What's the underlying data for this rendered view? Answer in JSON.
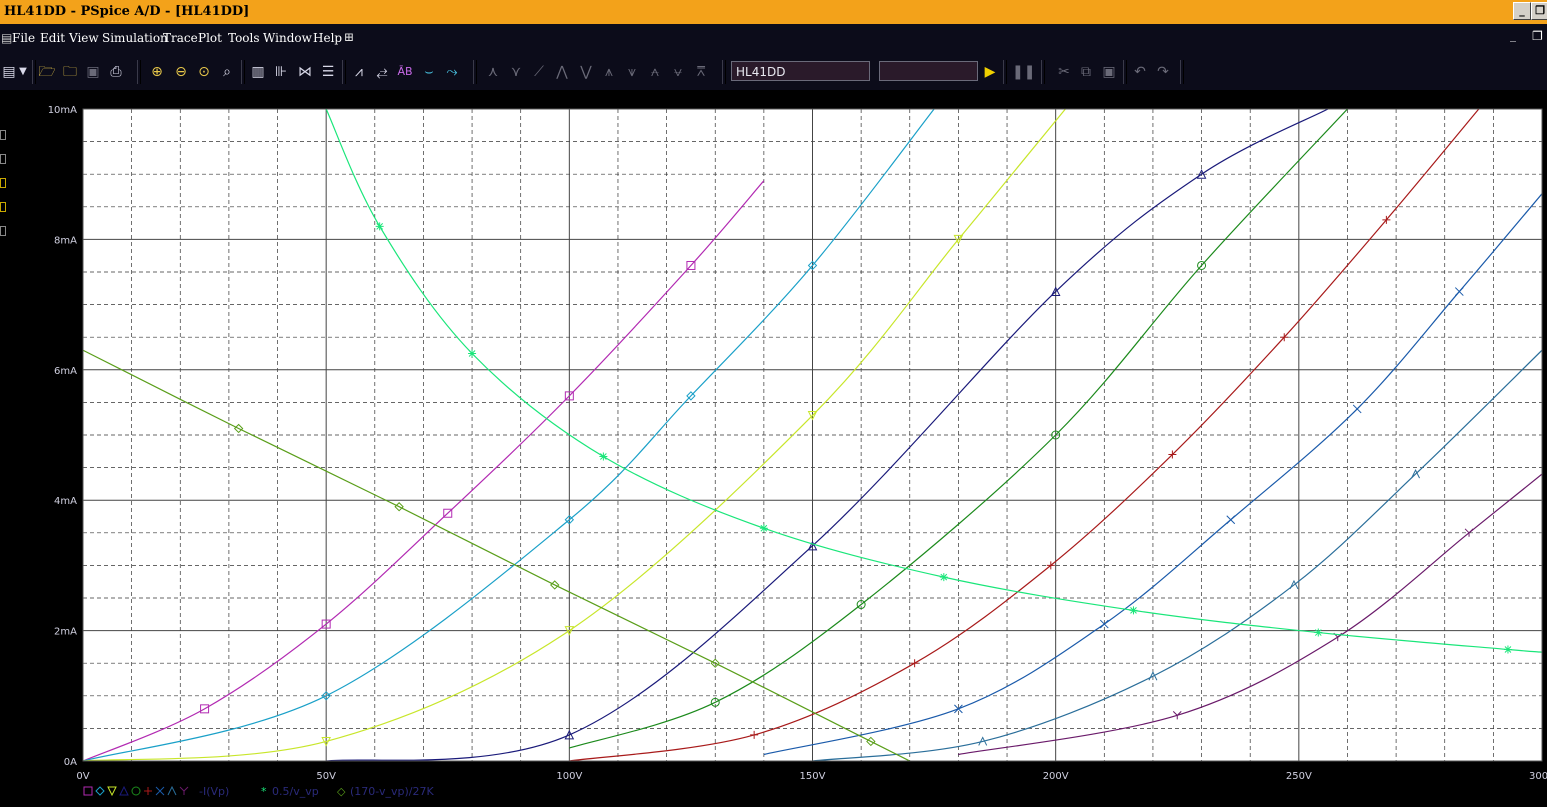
{
  "window": {
    "title": "HL41DD - PSpice A/D  - [HL41DD]"
  },
  "menu": {
    "items": [
      {
        "label": "File"
      },
      {
        "label": "Edit"
      },
      {
        "label": "View"
      },
      {
        "label": "Simulation"
      },
      {
        "label": "Trace"
      },
      {
        "label": "Plot"
      },
      {
        "label": "Tools"
      },
      {
        "label": "Window"
      },
      {
        "label": "Help"
      }
    ]
  },
  "toolbar": {
    "profile_name": "HL41DD",
    "sim_status": "",
    "icons": [
      "new-file-icon",
      "open-folder-icon",
      "open-icon",
      "save-icon",
      "print-icon",
      "zoom-in-icon",
      "zoom-out-icon",
      "zoom-area-icon",
      "zoom-fit-icon",
      "log-x-icon",
      "fourier-icon",
      "performance-icon",
      "table-icon",
      "add-trace-icon",
      "eval-goal-icon",
      "label-icon",
      "mark-icon",
      "cursor-icon",
      "run-icon",
      "pause-icon",
      "cut-icon",
      "copy-icon",
      "paste-icon",
      "undo-icon",
      "redo-icon"
    ]
  },
  "legend": {
    "current_label": "-I(Vp)",
    "load_label": "0.5/v_vp",
    "loadline_label": "(170-v_vp)/27K"
  },
  "chart_data": {
    "type": "line",
    "xlabel": "",
    "ylabel": "",
    "xlim": [
      0,
      300
    ],
    "ylim": [
      0,
      10
    ],
    "x_ticks": [
      "0V",
      "50V",
      "100V",
      "150V",
      "200V",
      "250V",
      "300V"
    ],
    "y_ticks": [
      "0A",
      "2mA",
      "4mA",
      "6mA",
      "8mA",
      "10mA"
    ],
    "grid": true,
    "series": [
      {
        "name": "-I(Vp)",
        "marker": "square",
        "color": "#b22ab2",
        "x": [
          0,
          25,
          50,
          75,
          100,
          125,
          140
        ],
        "y": [
          0,
          0.8,
          2.1,
          3.8,
          5.6,
          7.6,
          8.9
        ]
      },
      {
        "name": "-I(Vp)",
        "marker": "diamond",
        "color": "#1aa0c8",
        "x": [
          0,
          50,
          100,
          125,
          150,
          175
        ],
        "y": [
          0,
          1.0,
          3.7,
          5.6,
          7.6,
          10.0
        ]
      },
      {
        "name": "-I(Vp)",
        "marker": "triangle-down",
        "color": "#c8e62a",
        "x": [
          0,
          50,
          100,
          150,
          180,
          202
        ],
        "y": [
          0,
          0.3,
          2.0,
          5.3,
          8.0,
          10.0
        ]
      },
      {
        "name": "-I(Vp)",
        "marker": "triangle",
        "color": "#1a1a7a",
        "x": [
          50,
          100,
          150,
          200,
          230,
          256
        ],
        "y": [
          0,
          0.4,
          3.3,
          7.2,
          9.0,
          10.0
        ]
      },
      {
        "name": "-I(Vp)",
        "marker": "circle",
        "color": "#1c8a1c",
        "x": [
          100,
          130,
          160,
          200,
          230,
          260
        ],
        "y": [
          0.2,
          0.9,
          2.4,
          5.0,
          7.6,
          10.0
        ]
      },
      {
        "name": "-I(Vp)",
        "marker": "plus",
        "color": "#a81a1a",
        "x": [
          100,
          138,
          171,
          199,
          224,
          247,
          268,
          287
        ],
        "y": [
          0,
          0.4,
          1.5,
          3.0,
          4.7,
          6.5,
          8.3,
          10.0
        ]
      },
      {
        "name": "-I(Vp)",
        "marker": "x",
        "color": "#1a5aaa",
        "x": [
          140,
          180,
          210,
          236,
          262,
          283,
          300
        ],
        "y": [
          0.1,
          0.8,
          2.1,
          3.7,
          5.4,
          7.2,
          8.7
        ]
      },
      {
        "name": "-I(Vp)",
        "marker": "arrow",
        "color": "#2a6e9a",
        "x": [
          150,
          185,
          220,
          249,
          274,
          300
        ],
        "y": [
          0,
          0.3,
          1.3,
          2.7,
          4.4,
          6.3
        ]
      },
      {
        "name": "-I(Vp)",
        "marker": "y",
        "color": "#6a1a6a",
        "x": [
          180,
          225,
          258,
          285,
          300
        ],
        "y": [
          0.1,
          0.7,
          1.9,
          3.5,
          4.4
        ]
      },
      {
        "name": "0.5/v_vp",
        "marker": "asterisk",
        "color": "#1ae67a",
        "x": [
          50,
          61,
          80,
          107,
          140,
          177,
          216,
          254,
          293,
          300
        ],
        "y": [
          10,
          8.2,
          6.25,
          4.67,
          3.57,
          2.82,
          2.31,
          1.97,
          1.71,
          1.67
        ]
      },
      {
        "name": "(170-v_vp)/27K",
        "marker": "diamond",
        "color": "#5a9e1a",
        "x": [
          0,
          32,
          65,
          97,
          130,
          162,
          170
        ],
        "y": [
          6.3,
          5.1,
          3.9,
          2.7,
          1.5,
          0.3,
          0
        ]
      }
    ]
  }
}
